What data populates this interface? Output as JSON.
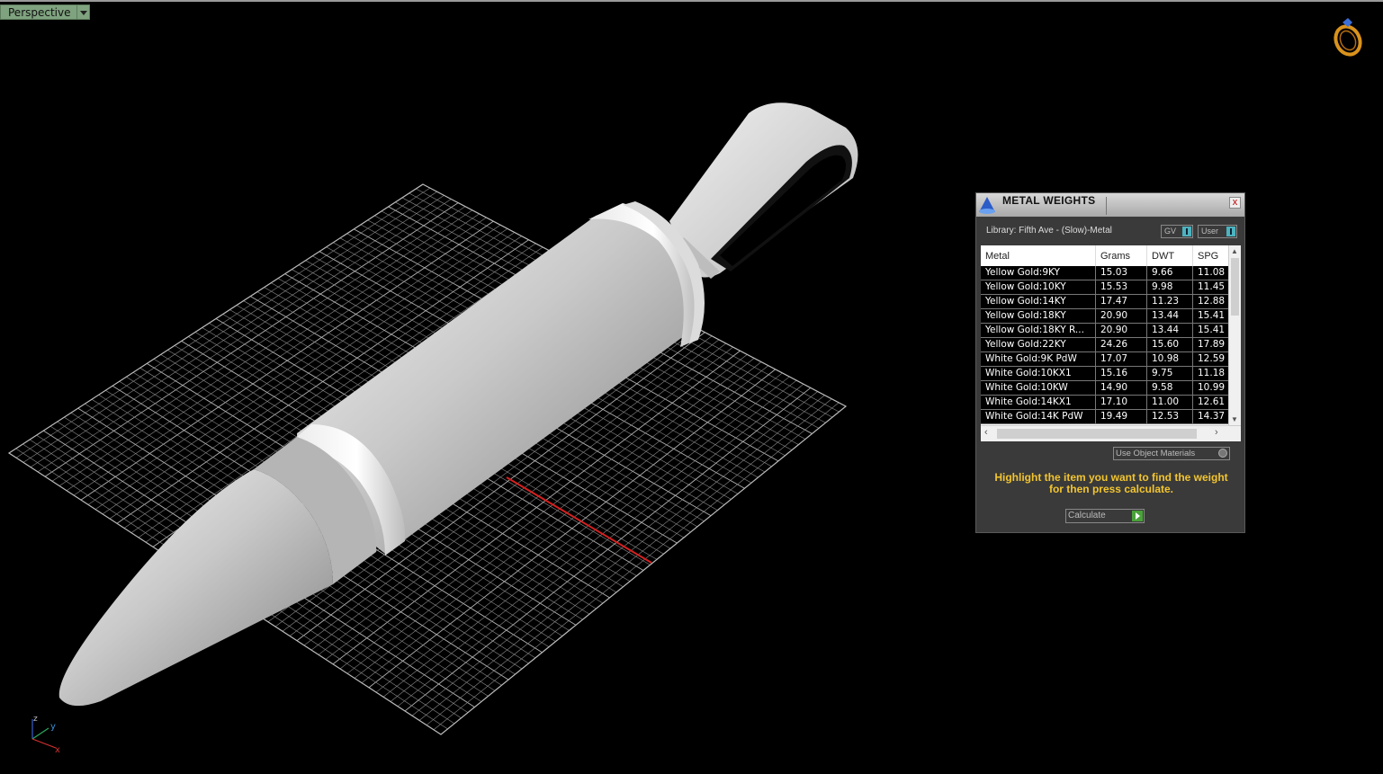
{
  "viewport": {
    "label": "Perspective"
  },
  "axes": {
    "x": "x",
    "y": "y",
    "z": "z"
  },
  "panel": {
    "title": "METAL WEIGHTS",
    "close": "x",
    "library": "Library: Fifth Ave - (Slow)-Metal",
    "gv_label": "GV",
    "user_label": "User",
    "columns": [
      "Metal",
      "Grams",
      "DWT",
      "SPG"
    ],
    "rows": [
      [
        "Yellow Gold:9KY",
        "15.03",
        "9.66",
        "11.08"
      ],
      [
        "Yellow Gold:10KY",
        "15.53",
        "9.98",
        "11.45"
      ],
      [
        "Yellow Gold:14KY",
        "17.47",
        "11.23",
        "12.88"
      ],
      [
        "Yellow Gold:18KY",
        "20.90",
        "13.44",
        "15.41"
      ],
      [
        "Yellow Gold:18KY R...",
        "20.90",
        "13.44",
        "15.41"
      ],
      [
        "Yellow Gold:22KY",
        "24.26",
        "15.60",
        "17.89"
      ],
      [
        "White Gold:9K PdW",
        "17.07",
        "10.98",
        "12.59"
      ],
      [
        "White Gold:10KX1",
        "15.16",
        "9.75",
        "11.18"
      ],
      [
        "White Gold:10KW",
        "14.90",
        "9.58",
        "10.99"
      ],
      [
        "White Gold:14KX1",
        "17.10",
        "11.00",
        "12.61"
      ],
      [
        "White Gold:14K PdW",
        "19.49",
        "12.53",
        "14.37"
      ]
    ],
    "use_object_materials": "Use Object Materials",
    "instruction": "Highlight the item you want to find the weight for then press calculate.",
    "calculate": "Calculate"
  },
  "colors": {
    "highlight_text": "#f2c530",
    "viewport_tab": "#7fa37f",
    "grid_axis": "#d42020"
  }
}
